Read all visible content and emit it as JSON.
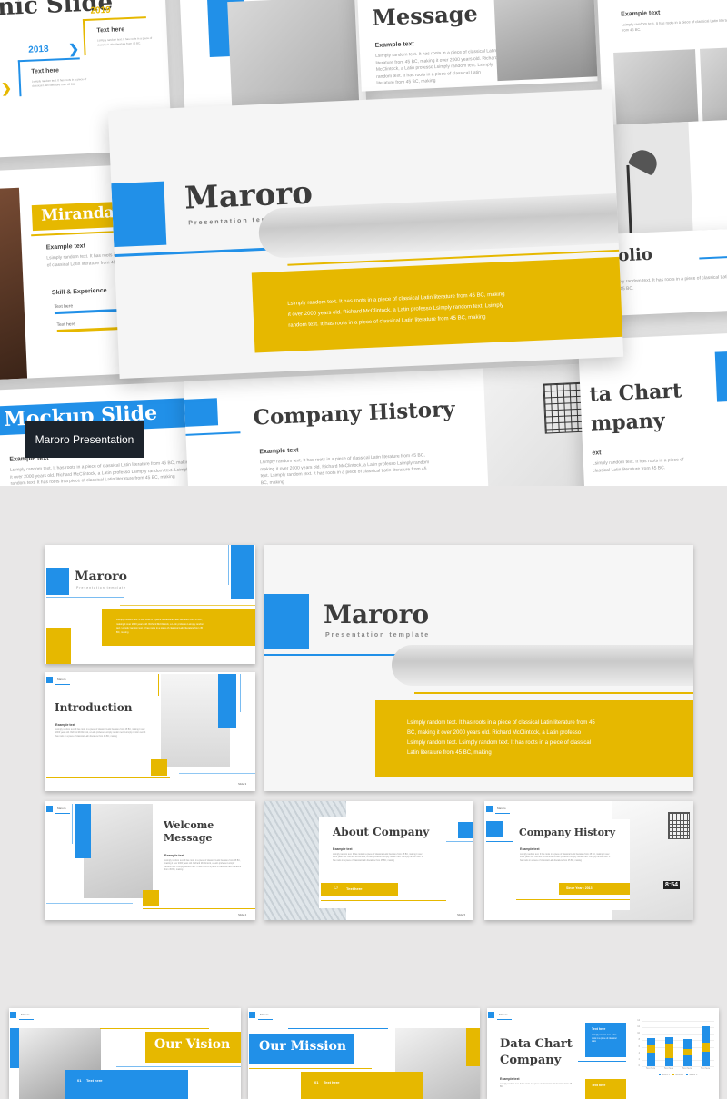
{
  "overlay_label": "Maroro Presentation",
  "brand": {
    "blue": "#2190e8",
    "yellow": "#e6b800",
    "dark": "#1c232b"
  },
  "lorem_short": "Lsimply random text. It has roots in a piece of classical Latin literature from 45 BC.",
  "lorem_long": "Lsimply random text. It has roots in a piece of classical Latin literature from 45 BC, making it over 2000 years old. Richard McClintock, a Latin professo Lsimply random text. Lsimply random text. It has roots in a piece of classical Latin literature from 45 BC, making",
  "hero": {
    "timeline": {
      "title": "nic Slide",
      "year1": "2018",
      "year2": "2019",
      "item_title": "Text here",
      "item_text": "Lsimply random text. It has roots in a piece of classical Latin literature from 45 BC."
    },
    "welcome_top": {
      "title": "Message",
      "subtitle": "Example text"
    },
    "team": {
      "subtitle": "Example text"
    },
    "miranda": {
      "name": "Miranda",
      "subtitle": "Example text",
      "skills_title": "Skill & Experience",
      "skill1": "Text here",
      "skill2": "Text here"
    },
    "cover": {
      "title": "Maroro",
      "subtitle": "Presentation template"
    },
    "portfolio": {
      "title": "tfolio"
    },
    "mockup": {
      "title": "Mockup Slide",
      "subtitle": "Example text"
    },
    "history": {
      "title": "Company History",
      "subtitle": "Example text"
    },
    "datachart": {
      "title1": "ta Chart",
      "title2": "mpany",
      "subtitle": "ext"
    }
  },
  "slides": {
    "cover_small": {
      "title": "Maroro",
      "subtitle": "Presentation template"
    },
    "intro": {
      "brand": "Maroro",
      "title": "Introduction",
      "subtitle": "Example text",
      "slide_no": "Slide 3"
    },
    "cover_large": {
      "title": "Maroro",
      "subtitle": "Presentation template"
    },
    "welcome": {
      "brand": "Maroro",
      "title1": "Welcome",
      "title2": "Message",
      "subtitle": "Example text",
      "slide_no": "Slide 4"
    },
    "about": {
      "title": "About Company",
      "subtitle": "Example text",
      "button": "Text here",
      "slide_no": "Slide 5"
    },
    "history": {
      "brand": "Maroro",
      "title": "Company History",
      "subtitle": "Example text",
      "badge": "Since Year : 2013",
      "clock": "8:54"
    },
    "vision": {
      "brand": "Maroro",
      "title": "Our Vision",
      "item_no": "01",
      "item_title": "Text here"
    },
    "mission": {
      "brand": "Maroro",
      "title": "Our Mission",
      "item_no": "01",
      "item_title": "Text here"
    },
    "datachart": {
      "brand": "Maroro",
      "title1": "Data Chart",
      "title2": "Company",
      "subtitle": "Example text",
      "box1_title": "Text here",
      "box1_text": "Lsimply random text. It has roots in a piece of classical Latin",
      "box2_title": "Text here"
    }
  },
  "chart_data": {
    "type": "bar",
    "stacked": true,
    "categories": [
      "Text here",
      "Text here",
      "Text here",
      "Text here"
    ],
    "series": [
      {
        "name": "Series 1",
        "values": [
          4.3,
          2.5,
          3.5,
          4.5
        ],
        "color": "#2190e8"
      },
      {
        "name": "Series 2",
        "values": [
          2.4,
          4.4,
          1.8,
          2.8
        ],
        "color": "#e6b800"
      },
      {
        "name": "Series 3",
        "values": [
          2,
          2,
          3,
          5
        ],
        "color": "#2190e8"
      }
    ],
    "ylim": [
      0,
      14
    ],
    "yticks": [
      "0",
      "2",
      "4",
      "6",
      "8",
      "10",
      "12",
      "14"
    ],
    "legend": "bottom"
  }
}
